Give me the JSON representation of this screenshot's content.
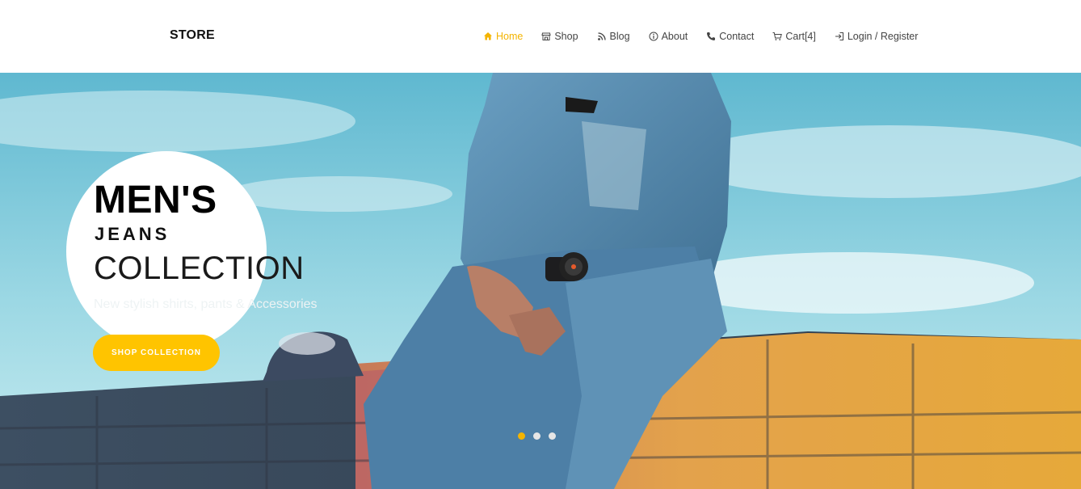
{
  "brand": "STORE",
  "nav": {
    "items": [
      {
        "label": "Home",
        "icon": "home-icon"
      },
      {
        "label": "Shop",
        "icon": "store-icon"
      },
      {
        "label": "Blog",
        "icon": "rss-icon"
      },
      {
        "label": "About",
        "icon": "info-icon"
      },
      {
        "label": "Contact",
        "icon": "phone-icon"
      },
      {
        "label": "Cart[4]",
        "icon": "cart-icon"
      },
      {
        "label": "Login / Register",
        "icon": "login-icon"
      }
    ],
    "active_index": 0
  },
  "hero": {
    "line1": "MEN'S",
    "line2": "JEANS",
    "line3": "COLLECTION",
    "subtitle": "New stylish shirts, pants & Accessories",
    "button": "SHOP COLLECTION",
    "slides_count": 3,
    "active_slide": 0
  },
  "colors": {
    "accent": "#f4b400",
    "button": "#ffc400",
    "sky": "#6fc3d6",
    "denim": "#5d8fb0"
  }
}
